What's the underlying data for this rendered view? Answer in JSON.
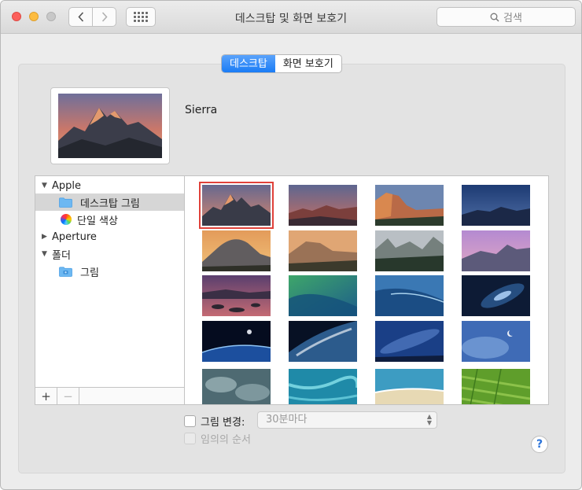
{
  "window": {
    "title": "데스크탑 및 화면 보호기",
    "search_placeholder": "검색"
  },
  "tabs": [
    {
      "label": "데스크탑",
      "active": true
    },
    {
      "label": "화면 보호기",
      "active": false
    }
  ],
  "current_wallpaper": {
    "name": "Sierra"
  },
  "sidebar": {
    "items": [
      {
        "label": "Apple",
        "type": "group",
        "expanded": true
      },
      {
        "label": "데스크탑 그림",
        "type": "folder",
        "selected": true
      },
      {
        "label": "단일 색상",
        "type": "colors"
      },
      {
        "label": "Aperture",
        "type": "group",
        "expanded": false
      },
      {
        "label": "폴더",
        "type": "group",
        "expanded": true
      },
      {
        "label": "그림",
        "type": "folder"
      }
    ],
    "add_label": "+",
    "remove_label": "−"
  },
  "wallpapers": [
    {
      "name": "sierra-mountain",
      "selected": true
    },
    {
      "name": "sierra-dusk-range"
    },
    {
      "name": "el-capitan-sunset"
    },
    {
      "name": "el-capitan-night"
    },
    {
      "name": "half-dome-sunset"
    },
    {
      "name": "el-capitan-sunrise"
    },
    {
      "name": "yosemite-valley"
    },
    {
      "name": "yosemite-pink-sky"
    },
    {
      "name": "lake-rocks-dusk"
    },
    {
      "name": "green-wave"
    },
    {
      "name": "blue-wave"
    },
    {
      "name": "galaxy"
    },
    {
      "name": "earth-horizon-moon"
    },
    {
      "name": "earth-clouds"
    },
    {
      "name": "milky-way"
    },
    {
      "name": "moon-clouds"
    },
    {
      "name": "storm-clouds"
    },
    {
      "name": "river-delta"
    },
    {
      "name": "beach-shore"
    },
    {
      "name": "green-fields"
    }
  ],
  "options": {
    "change_picture_label": "그림 변경:",
    "change_interval": "30분마다",
    "random_order_label": "임의의 순서",
    "help_label": "?"
  },
  "colors": {
    "accent": "#1a7cf5",
    "selection_outline": "#e0413a"
  }
}
